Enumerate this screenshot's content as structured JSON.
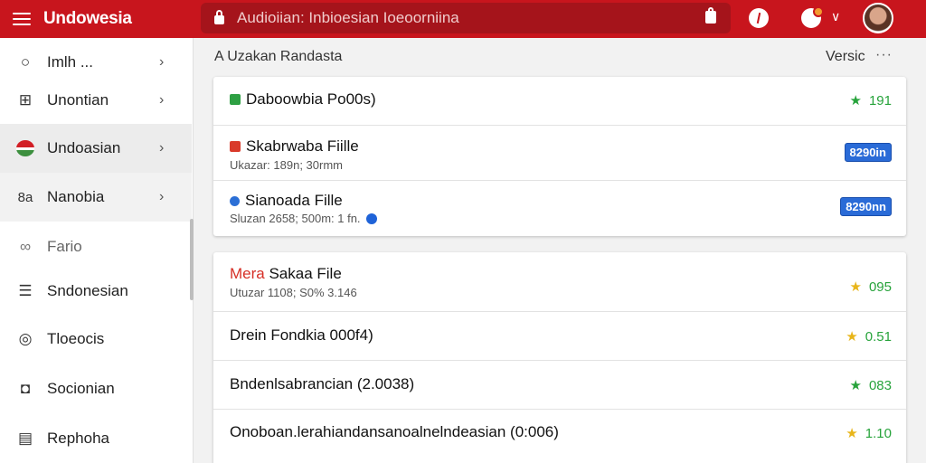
{
  "app": {
    "title": "Undowesia"
  },
  "search": {
    "placeholder": "Audioiian: Inbioesian Ioeoorniina"
  },
  "sidebar": {
    "items": [
      {
        "label": "Imlh ...",
        "icon": "circle-icon",
        "chevron": true,
        "state": "normal"
      },
      {
        "label": "Unontian",
        "icon": "grid-icon",
        "chevron": true,
        "state": "normal"
      },
      {
        "label": "Undoasian",
        "icon": "flag-icon",
        "chevron": true,
        "state": "active"
      },
      {
        "label": "Nanobia",
        "icon": "text-icon",
        "chevron": true,
        "state": "hover"
      },
      {
        "label": "Fario",
        "icon": "link-icon",
        "chevron": false,
        "state": "muted"
      },
      {
        "label": "Sndonesian",
        "icon": "list-icon",
        "chevron": false,
        "state": "normal"
      },
      {
        "label": "Tloeocis",
        "icon": "target-icon",
        "chevron": false,
        "state": "normal"
      },
      {
        "label": "Socionian",
        "icon": "person-icon",
        "chevron": false,
        "state": "normal"
      },
      {
        "label": "Rephoha",
        "icon": "doc-icon",
        "chevron": false,
        "state": "normal"
      }
    ]
  },
  "main": {
    "section_title": "A Uzakan Randasta",
    "version_label": "Versic",
    "more_label": "···",
    "card1": {
      "rows": [
        {
          "title": "Daboowbia Po00s)",
          "subtitle": "",
          "rating": "191",
          "badge": "",
          "icon": "green-square-icon"
        },
        {
          "title": "Skabrwaba Fiille",
          "subtitle": "Ukazar: 189n; 30rmm",
          "rating": "",
          "badge": "8290in",
          "icon": "red-square-icon"
        },
        {
          "title": "Sianoada Fille",
          "subtitle": "Sluzan 2658; 500m: 1 fn.",
          "rating": "",
          "badge": "8290nn",
          "icon": "person-icon"
        }
      ]
    },
    "card2": {
      "rows": [
        {
          "title_highlight": "Mera",
          "title": " Sakaa File",
          "subtitle": "Utuzar 1108; S0% 3.146",
          "rating": "095",
          "star": "yellow"
        },
        {
          "title_highlight": "",
          "title": "Drein Fondkia 000f4)",
          "subtitle": "",
          "rating": "0.51",
          "star": "yellow"
        },
        {
          "title_highlight": "",
          "title": "Bndenlsabrancian (2.0038)",
          "subtitle": "",
          "rating": "083",
          "star": "green"
        },
        {
          "title_highlight": "",
          "title": "Onoboan.lerahiandansanoalnelndeasian (0:006)",
          "subtitle": "",
          "rating": "1.10",
          "star": "yellow"
        }
      ]
    }
  },
  "colors": {
    "brand": "#c8151d",
    "accent_blue": "#2a6bd7",
    "rating_green": "#27a33b",
    "star_yellow": "#e8b51a"
  }
}
